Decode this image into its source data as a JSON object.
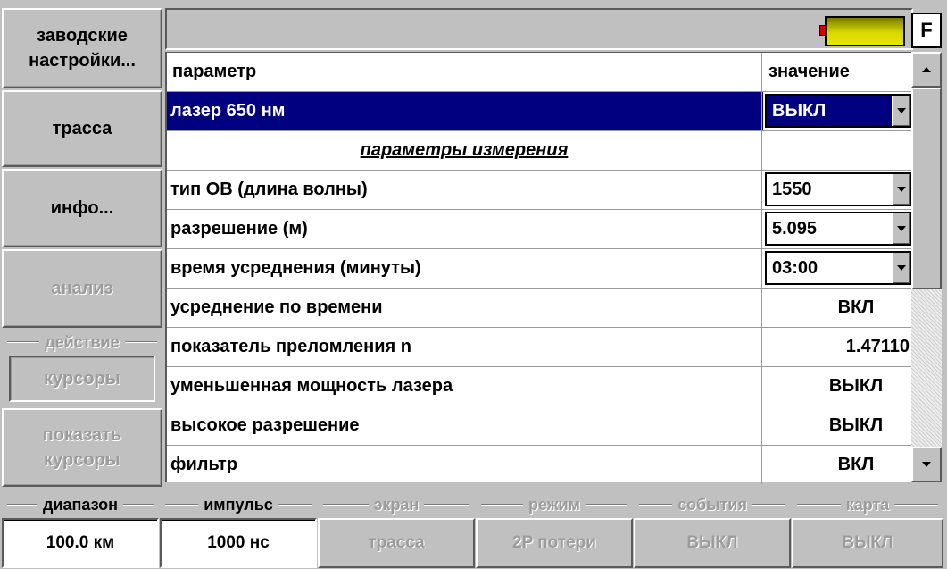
{
  "sidebar": {
    "factory_settings": "заводские настройки...",
    "trace": "трасса",
    "info": "инфо...",
    "analysis": "анализ",
    "action_group": "действие",
    "cursors": "курсоры",
    "show_cursors": "показать курсоры"
  },
  "topbar": {
    "f_button": "F",
    "battery_color": "#d8d800"
  },
  "table": {
    "col_param": "параметр",
    "col_value": "значение",
    "rows": [
      {
        "param": "лазер 650 нм",
        "value": "ВЫКЛ",
        "type": "combo",
        "selected": true
      },
      {
        "param": "параметры измерения",
        "value": "",
        "type": "section"
      },
      {
        "param": "тип ОВ (длина волны)",
        "value": "1550",
        "type": "combo"
      },
      {
        "param": "разрешение (м)",
        "value": "5.095",
        "type": "combo"
      },
      {
        "param": "время усреднения (минуты)",
        "value": "03:00",
        "type": "combo"
      },
      {
        "param": "усреднение по времени",
        "value": "ВКЛ",
        "type": "text"
      },
      {
        "param": "показатель преломления n",
        "value": "1.47110",
        "type": "number"
      },
      {
        "param": "уменьшенная мощность лазера",
        "value": "ВЫКЛ",
        "type": "text"
      },
      {
        "param": "высокое разрешение",
        "value": "ВЫКЛ",
        "type": "text"
      },
      {
        "param": "фильтр",
        "value": "ВКЛ",
        "type": "text"
      }
    ]
  },
  "bottombar": [
    {
      "label": "диапазон",
      "value": "100.0 км",
      "enabled": true
    },
    {
      "label": "импульс",
      "value": "1000 нс",
      "enabled": true
    },
    {
      "label": "экран",
      "value": "трасса",
      "enabled": false
    },
    {
      "label": "режим",
      "value": "2P потери",
      "enabled": false
    },
    {
      "label": "события",
      "value": "ВЫКЛ",
      "enabled": false
    },
    {
      "label": "карта",
      "value": "ВЫКЛ",
      "enabled": false
    }
  ],
  "colors": {
    "selection": "#000080",
    "panel": "#c0c0c0"
  }
}
